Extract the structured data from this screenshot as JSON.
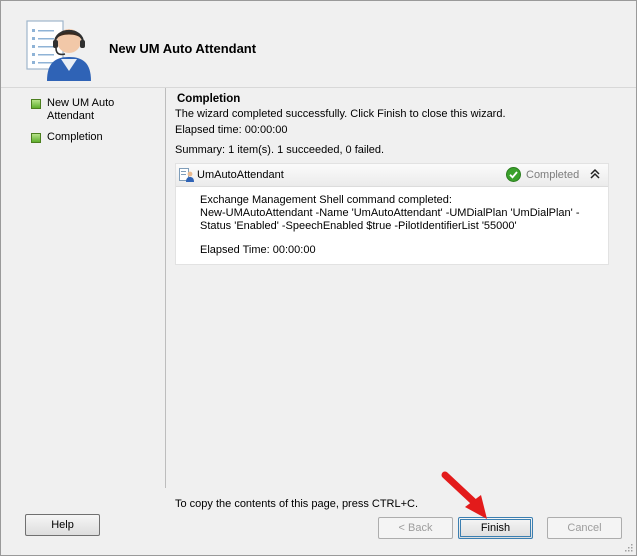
{
  "window": {
    "title": "New UM Auto Attendant"
  },
  "icons": {
    "header": "user-headset-icon",
    "task": "task-user-icon",
    "status": "checkmark-icon",
    "collapse": "double-chevron-up-icon",
    "nav": "green-square-icon",
    "arrow": "red-arrow-icon"
  },
  "nav": {
    "items": [
      {
        "label": "New UM Auto Attendant"
      },
      {
        "label": "Completion"
      }
    ]
  },
  "content": {
    "title": "Completion",
    "intro": "The wizard completed successfully. Click Finish to close this wizard.",
    "elapsed": "Elapsed time: 00:00:00",
    "summary": "Summary: 1 item(s). 1 succeeded, 0 failed.",
    "task": {
      "name": "UmAutoAttendant",
      "status": "Completed",
      "detail": "Exchange Management Shell command completed:\nNew-UMAutoAttendant -Name 'UmAutoAttendant' -UMDialPlan 'UmDialPlan' -Status 'Enabled' -SpeechEnabled $true -PilotIdentifierList '55000'",
      "elapsed": "Elapsed Time: 00:00:00"
    },
    "copy_hint": "To copy the contents of this page, press CTRL+C."
  },
  "buttons": {
    "help": "Help",
    "back": "< Back",
    "finish": "Finish",
    "cancel": "Cancel"
  },
  "colors": {
    "success": "#3aa12b",
    "arrow": "#e31b1b",
    "nav_square": "#5fae2c"
  }
}
